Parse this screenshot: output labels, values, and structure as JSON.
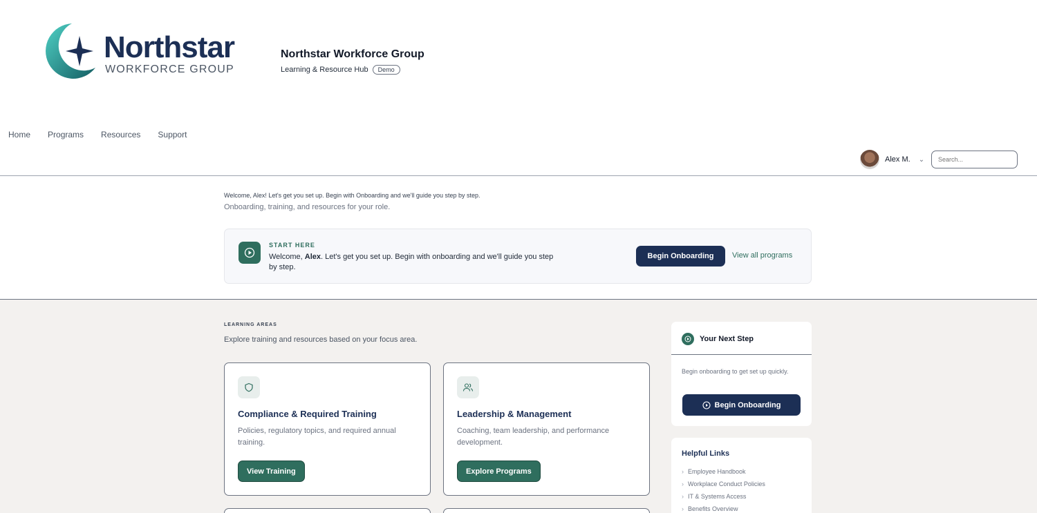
{
  "logo": {
    "name": "Northstar",
    "tagline": "WORKFORCE GROUP"
  },
  "brand": {
    "title": "Northstar Workforce Group",
    "subtitle": "Learning & Resource Hub",
    "badge": "Demo"
  },
  "nav": {
    "items": [
      "Home",
      "Programs",
      "Resources",
      "Support"
    ]
  },
  "user": {
    "name": "Alex M."
  },
  "search": {
    "placeholder": "Search..."
  },
  "welcome": {
    "message": "Welcome, Alex! Let's get you set up. Begin with Onboarding and we'll guide you step by step.",
    "subtitle": "Onboarding, training, and resources for your role."
  },
  "start_here": {
    "label": "START HERE",
    "text_prefix": "Welcome, ",
    "text_name": "Alex",
    "text_suffix": ". Let's get you set up. Begin with onboarding and we'll guide you step by step.",
    "button": "Begin Onboarding",
    "link": "View all programs"
  },
  "learning_areas": {
    "title": "LEARNING AREAS",
    "subtitle": "Explore training and resources based on your focus area.",
    "cards": [
      {
        "icon": "shield-icon",
        "title": "Compliance & Required Training",
        "description": "Policies, regulatory topics, and required annual training.",
        "button": "View Training"
      },
      {
        "icon": "users-icon",
        "title": "Leadership & Management",
        "description": "Coaching, team leadership, and performance development.",
        "button": "Explore Programs"
      }
    ]
  },
  "next_step": {
    "title": "Your Next Step",
    "text": "Begin onboarding to get set up quickly.",
    "button": "Begin Onboarding"
  },
  "helpful_links": {
    "title": "Helpful Links",
    "items": [
      "Employee Handbook",
      "Workplace Conduct Policies",
      "IT & Systems Access",
      "Benefits Overview"
    ]
  },
  "colors": {
    "navy": "#1c2f55",
    "teal": "#2f6e5e",
    "panel": "#f3f1ef"
  }
}
